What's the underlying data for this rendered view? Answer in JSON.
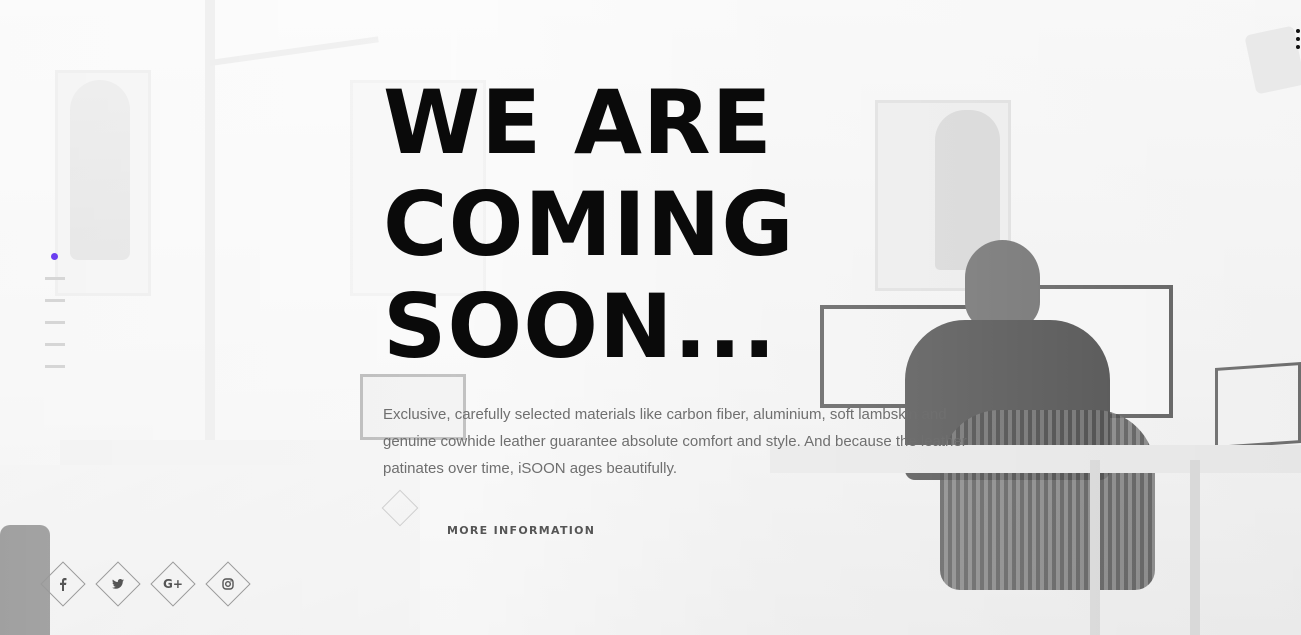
{
  "menu": {
    "icon": "menu-dots-icon"
  },
  "pager": {
    "active_color": "#6b3ef0",
    "slides": 5,
    "active_index": 0
  },
  "hero": {
    "headline_lines": [
      "WE ARE",
      "COMING",
      "SOON..."
    ],
    "description": "Exclusive, carefully selected materials like carbon fiber, aluminium, soft lambskin and genuine cowhide leather guarantee absolute comfort and style. And because the leather patinates over time, iSOON ages beautifully.",
    "more_label": "MORE INFORMATION"
  },
  "social": [
    {
      "name": "facebook",
      "icon": "facebook-icon",
      "glyph": "f"
    },
    {
      "name": "twitter",
      "icon": "twitter-icon",
      "glyph": "🐦"
    },
    {
      "name": "google-plus",
      "icon": "google-plus-icon",
      "glyph": "G+"
    },
    {
      "name": "instagram",
      "icon": "instagram-icon",
      "glyph": "◎"
    }
  ]
}
